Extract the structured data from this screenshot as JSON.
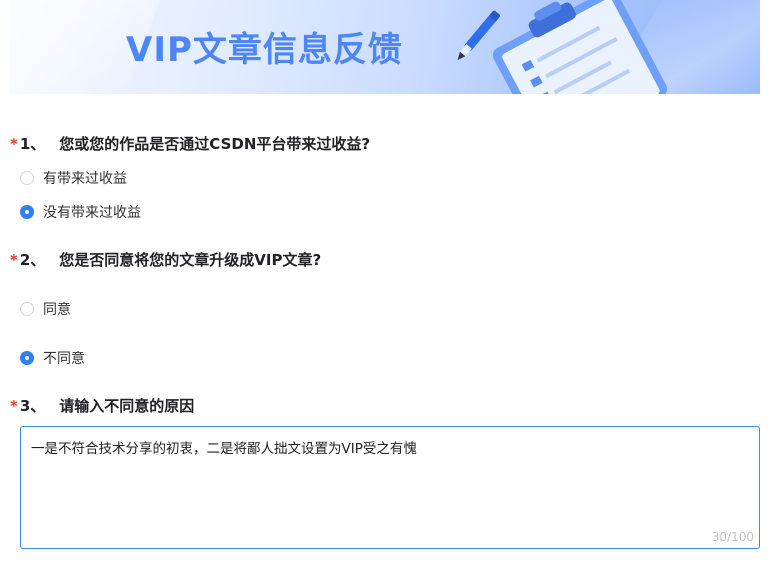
{
  "banner": {
    "title": "VIP文章信息反馈"
  },
  "questions": [
    {
      "star": "*",
      "number": "1、",
      "text": "您或您的作品是否通过CSDN平台带来过收益?",
      "options": [
        {
          "label": "有带来过收益",
          "checked": false
        },
        {
          "label": "没有带来过收益",
          "checked": true
        }
      ]
    },
    {
      "star": "*",
      "number": "2、",
      "text": "您是否同意将您的文章升级成VIP文章?",
      "options": [
        {
          "label": "同意",
          "checked": false
        },
        {
          "label": "不同意",
          "checked": true
        }
      ]
    },
    {
      "star": "*",
      "number": "3、",
      "text": "请输入不同意的原因",
      "answer": "一是不符合技术分享的初衷，二是将鄙人拙文设置为VIP受之有愧",
      "counter": "30/100"
    }
  ],
  "colors": {
    "accent": "#2f80f5",
    "required_star": "#e33e33",
    "banner_title": "#4d86f5"
  }
}
